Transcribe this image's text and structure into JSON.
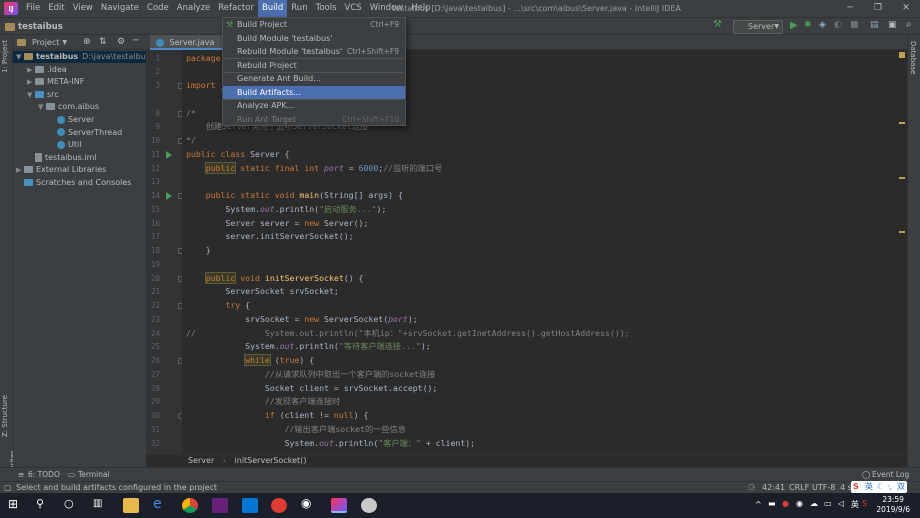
{
  "menubar": {
    "items": [
      "File",
      "Edit",
      "View",
      "Navigate",
      "Code",
      "Analyze",
      "Refactor",
      "Build",
      "Run",
      "Tools",
      "VCS",
      "Window",
      "Help"
    ],
    "active": "Build",
    "title": "testaibus [D:\\java\\testaibus] - ...\\src\\com\\aibus\\Server.java - IntelliJ IDEA"
  },
  "navbar": {
    "project": "testaibus",
    "run_config": "Server"
  },
  "build_menu": {
    "items": [
      {
        "label": "Build Project",
        "shortcut": "Ctrl+F9",
        "highlighted": false,
        "disabled": false
      },
      {
        "label": "Build Module 'testaibus'",
        "shortcut": "",
        "highlighted": false,
        "disabled": false
      },
      {
        "label": "Rebuild Module 'testaibus'",
        "shortcut": "Ctrl+Shift+F9",
        "highlighted": false,
        "disabled": false
      },
      {
        "label": "Rebuild Project",
        "shortcut": "",
        "highlighted": false,
        "disabled": false
      },
      {
        "label": "Generate Ant Build...",
        "shortcut": "",
        "highlighted": false,
        "disabled": false
      },
      {
        "label": "Build Artifacts...",
        "shortcut": "",
        "highlighted": true,
        "disabled": false
      },
      {
        "label": "Analyze APK...",
        "shortcut": "",
        "highlighted": false,
        "disabled": false
      },
      {
        "label": "Run Ant Target",
        "shortcut": "Ctrl+Shift+F10",
        "highlighted": false,
        "disabled": true
      }
    ]
  },
  "project_panel": {
    "header": "Project",
    "tree": [
      {
        "label": "testaibus",
        "path": "D:\\java\\testaibus",
        "depth": 0,
        "arrow": "▼",
        "icon": "root-folder",
        "selected": true
      },
      {
        "label": ".idea",
        "depth": 1,
        "arrow": "▶",
        "icon": "folder"
      },
      {
        "label": "META-INF",
        "depth": 1,
        "arrow": "▶",
        "icon": "folder"
      },
      {
        "label": "src",
        "depth": 1,
        "arrow": "▼",
        "icon": "src-folder"
      },
      {
        "label": "com.aibus",
        "depth": 2,
        "arrow": "▼",
        "icon": "folder"
      },
      {
        "label": "Server",
        "depth": 3,
        "arrow": "",
        "icon": "java-class"
      },
      {
        "label": "ServerThread",
        "depth": 3,
        "arrow": "",
        "icon": "java-class"
      },
      {
        "label": "Util",
        "depth": 3,
        "arrow": "",
        "icon": "java-class"
      },
      {
        "label": "testaibus.iml",
        "depth": 1,
        "arrow": "",
        "icon": "file"
      },
      {
        "label": "External Libraries",
        "depth": 0,
        "arrow": "▶",
        "icon": "library"
      },
      {
        "label": "Scratches and Consoles",
        "depth": 0,
        "arrow": "",
        "icon": "scratch"
      }
    ]
  },
  "editor": {
    "tab": "Server.java",
    "breadcrumb": [
      "Server",
      "initServerSocket()"
    ],
    "line_numbers": [
      "1",
      "2",
      "3",
      "8",
      "9",
      "10",
      "11",
      "12",
      "13",
      "14",
      "15",
      "16",
      "17",
      "18",
      "19",
      "20",
      "21",
      "22",
      "23",
      "24",
      "25",
      "26",
      "27",
      "28",
      "29",
      "30",
      "31",
      "32"
    ]
  },
  "left_stripe": {
    "project_tab": "1: Project",
    "structure_tab": "Z: Structure",
    "favorites_tab": "2: Favorites"
  },
  "right_stripe": {
    "database_tab": "Database"
  },
  "bottom_tools": {
    "todo": "6: TODO",
    "terminal": "Terminal",
    "event_log": "Event Log"
  },
  "status_bar": {
    "message": "Select and build artifacts configured in the project",
    "position": "42:41",
    "line_sep": "CRLF",
    "encoding": "UTF-8",
    "indent": "4 s"
  },
  "taskbar": {
    "time": "23:59",
    "date": "2019/9/6",
    "ime": "英",
    "ime_mode": "双"
  }
}
